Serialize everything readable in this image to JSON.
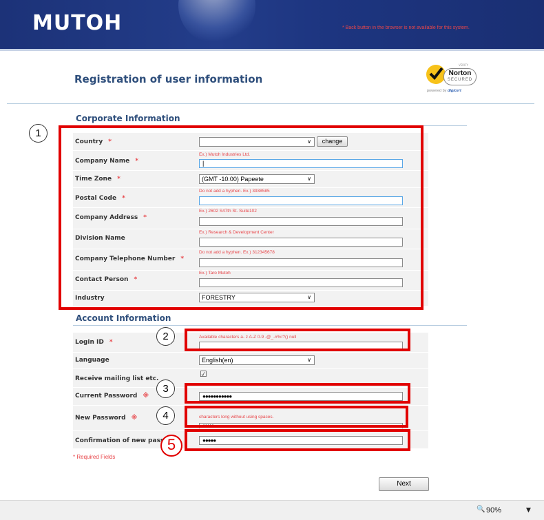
{
  "header": {
    "logo": "MUTOH",
    "back_notice": "* Back button in the browser is not available for this system."
  },
  "page_title": "Registration of user information",
  "norton": {
    "verify": "VERIFY",
    "name": "Norton",
    "secured": "SECURED",
    "powered": "powered by",
    "brand": "digicert"
  },
  "corporate": {
    "title": "Corporate Information",
    "country": {
      "label": "Country",
      "req": "*",
      "value": "",
      "change_label": "change"
    },
    "company_name": {
      "label": "Company Name",
      "req": "*",
      "hint": "Ex.) Mutoh Industries Ltd.",
      "value": "|"
    },
    "time_zone": {
      "label": "Time Zone",
      "req": "*",
      "value": "(GMT -10:00) Papeete"
    },
    "postal_code": {
      "label": "Postal Code",
      "req": "*",
      "hint": "Do not add a hyphen. Ex.) 3938585",
      "value": ""
    },
    "company_address": {
      "label": "Company Address",
      "req": "*",
      "hint": "Ex.) 2602 S47th St. Suite102",
      "value": ""
    },
    "division_name": {
      "label": "Division Name",
      "hint": "Ex.) Research & Development Center",
      "value": ""
    },
    "company_phone": {
      "label": "Company Telephone Number",
      "req": "*",
      "hint": "Do not add a hyphen. Ex.) 312345678",
      "value": ""
    },
    "contact_person": {
      "label": "Contact Person",
      "req": "*",
      "hint": "Ex.) Taro Mutoh",
      "value": ""
    },
    "industry": {
      "label": "Industry",
      "value": "FORESTRY"
    }
  },
  "account": {
    "title": "Account Information",
    "login_id": {
      "label": "Login ID",
      "req": "*",
      "hint": "Available characters a- z  A-Z 0-9 .@_-#%!?() null",
      "value": ""
    },
    "language": {
      "label": "Language",
      "value": "English(en)"
    },
    "mailing": {
      "label": "Receive mailing list etc.",
      "checked": true,
      "check_glyph": "☑"
    },
    "current_password": {
      "label": "Current Password",
      "req": "※",
      "value": "●●●●●●●●●●●"
    },
    "new_password": {
      "label": "New Password",
      "req": "※",
      "hint": "characters long without using spaces.",
      "value": "●●●●●"
    },
    "confirm_password": {
      "label": "Confirmation of new pass",
      "value": "●●●●●"
    }
  },
  "callouts": [
    "1",
    "2",
    "3",
    "4",
    "5"
  ],
  "required_note": "* Required Fields",
  "next_label": "Next",
  "zoom": "90%",
  "zoom_icon": "🔍",
  "zoom_arrow": "▼"
}
